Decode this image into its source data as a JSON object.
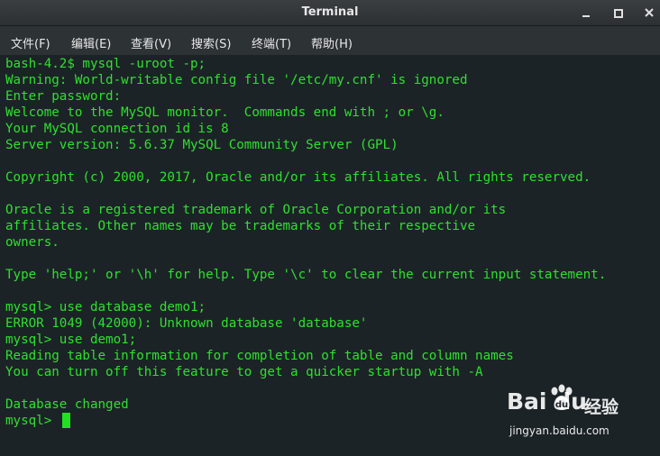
{
  "window": {
    "title": "Terminal"
  },
  "menu": {
    "file": "文件(F)",
    "edit": "编辑(E)",
    "view": "查看(V)",
    "search": "搜索(S)",
    "terminal": "终端(T)",
    "help": "帮助(H)"
  },
  "terminal": {
    "lines": [
      "bash-4.2$ mysql -uroot -p;",
      "Warning: World-writable config file '/etc/my.cnf' is ignored",
      "Enter password:",
      "Welcome to the MySQL monitor.  Commands end with ; or \\g.",
      "Your MySQL connection id is 8",
      "Server version: 5.6.37 MySQL Community Server (GPL)",
      "",
      "Copyright (c) 2000, 2017, Oracle and/or its affiliates. All rights reserved.",
      "",
      "Oracle is a registered trademark of Oracle Corporation and/or its",
      "affiliates. Other names may be trademarks of their respective",
      "owners.",
      "",
      "Type 'help;' or '\\h' for help. Type '\\c' to clear the current input statement.",
      "",
      "mysql> use database demo1;",
      "ERROR 1049 (42000): Unknown database 'database'",
      "mysql> use demo1;",
      "Reading table information for completion of table and column names",
      "You can turn off this feature to get a quicker startup with -A",
      "",
      "Database changed",
      "mysql> "
    ],
    "text_color": "#2ee02e",
    "background_color": "#1c2327"
  },
  "watermark": {
    "logo": "Bai  du",
    "subtitle": "经验",
    "url": "jingyan.baidu.com"
  }
}
